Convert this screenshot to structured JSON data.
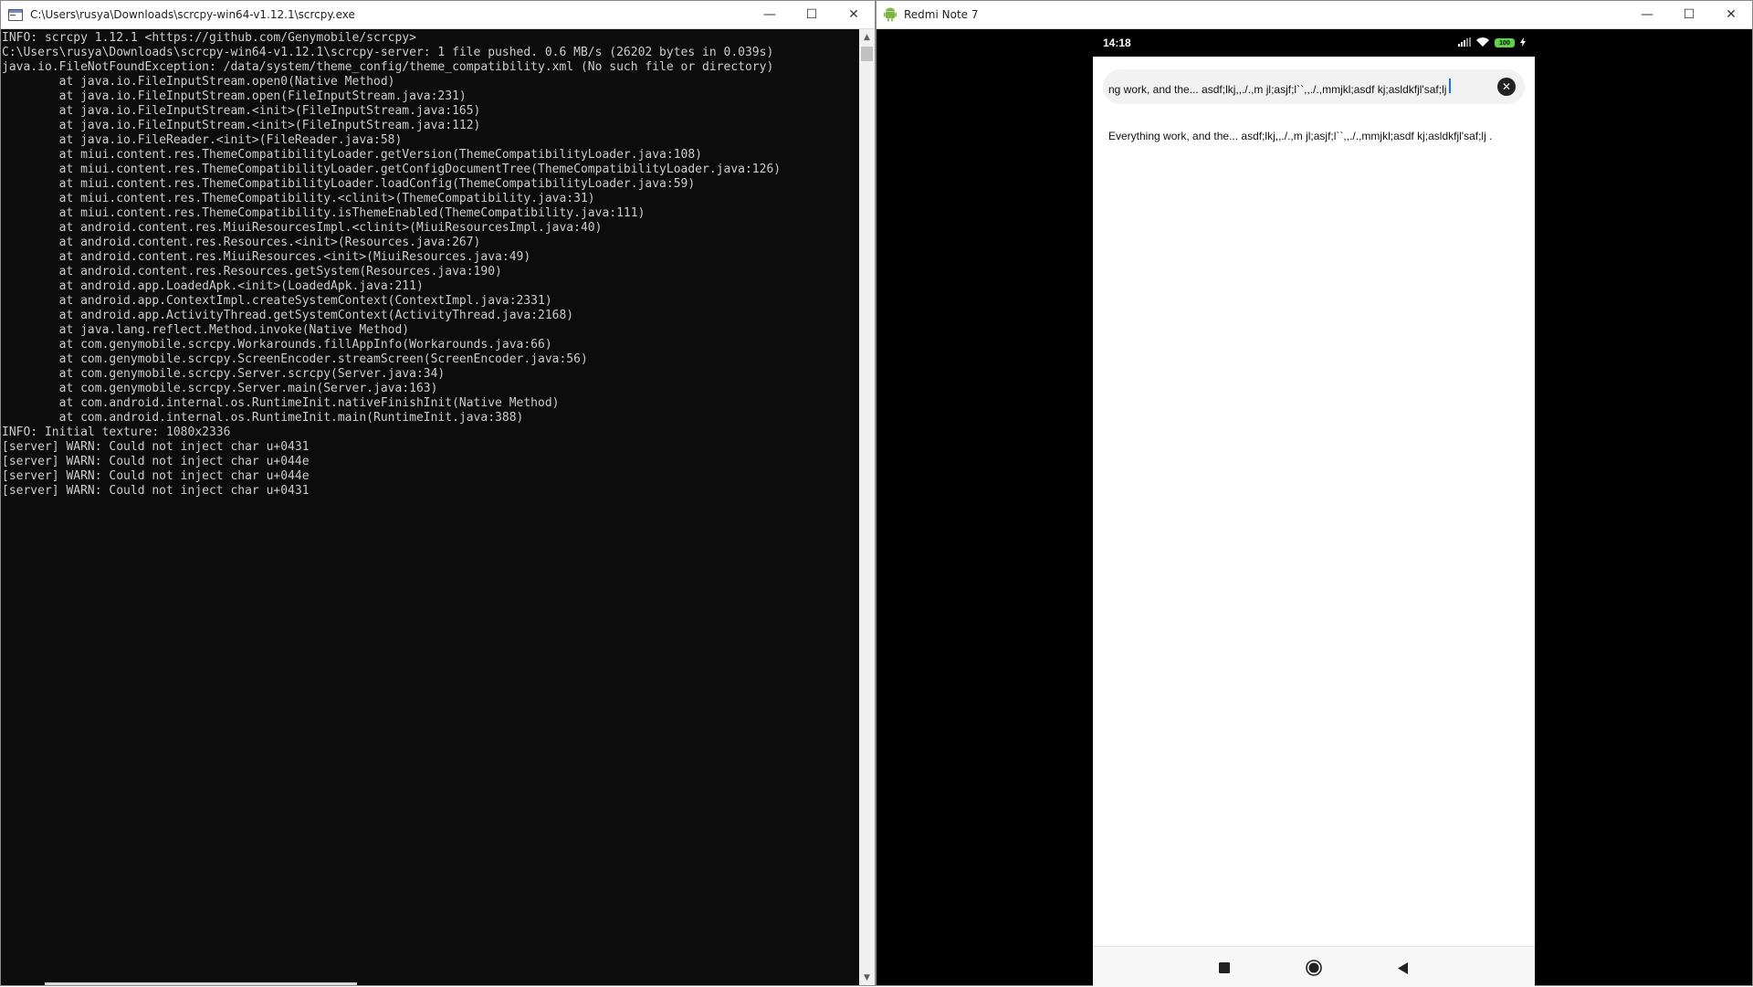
{
  "console_window": {
    "title": "C:\\Users\\rusya\\Downloads\\scrcpy-win64-v1.12.1\\scrcpy.exe",
    "controls": {
      "minimize": "—",
      "maximize": "☐",
      "close": "✕"
    },
    "lines": [
      "INFO: scrcpy 1.12.1 <https://github.com/Genymobile/scrcpy>",
      "C:\\Users\\rusya\\Downloads\\scrcpy-win64-v1.12.1\\scrcpy-server: 1 file pushed. 0.6 MB/s (26202 bytes in 0.039s)",
      "java.io.FileNotFoundException: /data/system/theme_config/theme_compatibility.xml (No such file or directory)",
      "        at java.io.FileInputStream.open0(Native Method)",
      "        at java.io.FileInputStream.open(FileInputStream.java:231)",
      "        at java.io.FileInputStream.<init>(FileInputStream.java:165)",
      "        at java.io.FileInputStream.<init>(FileInputStream.java:112)",
      "        at java.io.FileReader.<init>(FileReader.java:58)",
      "        at miui.content.res.ThemeCompatibilityLoader.getVersion(ThemeCompatibilityLoader.java:108)",
      "        at miui.content.res.ThemeCompatibilityLoader.getConfigDocumentTree(ThemeCompatibilityLoader.java:126)",
      "        at miui.content.res.ThemeCompatibilityLoader.loadConfig(ThemeCompatibilityLoader.java:59)",
      "        at miui.content.res.ThemeCompatibility.<clinit>(ThemeCompatibility.java:31)",
      "        at miui.content.res.ThemeCompatibility.isThemeEnabled(ThemeCompatibility.java:111)",
      "        at android.content.res.MiuiResourcesImpl.<clinit>(MiuiResourcesImpl.java:40)",
      "        at android.content.res.Resources.<init>(Resources.java:267)",
      "        at android.content.res.MiuiResources.<init>(MiuiResources.java:49)",
      "        at android.content.res.Resources.getSystem(Resources.java:190)",
      "        at android.app.LoadedApk.<init>(LoadedApk.java:211)",
      "        at android.app.ContextImpl.createSystemContext(ContextImpl.java:2331)",
      "        at android.app.ActivityThread.getSystemContext(ActivityThread.java:2168)",
      "        at java.lang.reflect.Method.invoke(Native Method)",
      "        at com.genymobile.scrcpy.Workarounds.fillAppInfo(Workarounds.java:66)",
      "        at com.genymobile.scrcpy.ScreenEncoder.streamScreen(ScreenEncoder.java:56)",
      "        at com.genymobile.scrcpy.Server.scrcpy(Server.java:34)",
      "        at com.genymobile.scrcpy.Server.main(Server.java:163)",
      "        at com.android.internal.os.RuntimeInit.nativeFinishInit(Native Method)",
      "        at com.android.internal.os.RuntimeInit.main(RuntimeInit.java:388)",
      "INFO: Initial texture: 1080x2336",
      "[server] WARN: Could not inject char u+0431",
      "[server] WARN: Could not inject char u+044e",
      "[server] WARN: Could not inject char u+044e",
      "[server] WARN: Could not inject char u+0431"
    ],
    "scroll": {
      "up": "▲",
      "down": "▼"
    }
  },
  "phone_window": {
    "title": "Redmi Note 7",
    "controls": {
      "minimize": "—",
      "maximize": "☐",
      "close": "✕"
    },
    "status_bar": {
      "time": "14:18",
      "battery": "100"
    },
    "search": {
      "value": "ng work, and the... asdf;lkj,,./.,m jl;asjf;l``,,./.,mmjkl;asdf kj;asldkfjl'saf;lj",
      "clear_icon": "✕"
    },
    "result_text": "Everything work, and the... asdf;lkj,,./.,m jl;asjf;l``,,./.,mmjkl;asdf kj;asldkfjl'saf;lj .",
    "icons": {
      "android": "android-icon",
      "signal": "signal-icon",
      "wifi": "wifi-icon",
      "battery": "battery-icon",
      "charging": "charging-icon",
      "recents": "recents-icon",
      "home": "home-icon",
      "back": "back-icon"
    },
    "colors": {
      "accent": "#1a73e8",
      "battery": "#5fd34a",
      "android": "#7cb342"
    }
  }
}
